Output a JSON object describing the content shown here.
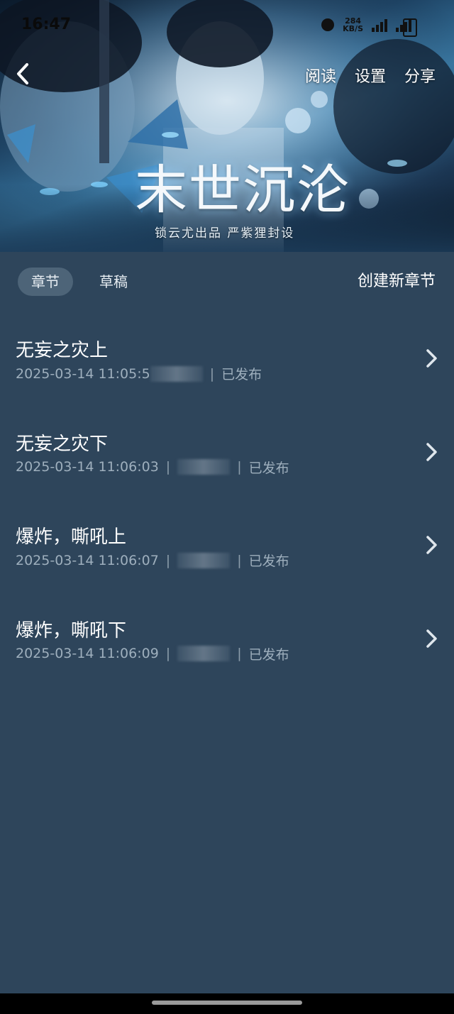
{
  "status_bar": {
    "time": "16:47",
    "net_speed": "284",
    "net_unit": "KB/S"
  },
  "header": {
    "back_icon": "chevron-left-icon",
    "actions": [
      "阅读",
      "设置",
      "分享"
    ]
  },
  "cover": {
    "title": "末世沉沦",
    "credits": "锁云尤出品  严紫狸封设"
  },
  "tabs": {
    "items": [
      "章节",
      "草稿"
    ],
    "selected": "章节",
    "create_label": "创建新章节"
  },
  "chapters": [
    {
      "title": "无妄之灾上",
      "time": "2025-03-14 11:05:5",
      "status": "已发布"
    },
    {
      "title": "无妄之灾下",
      "time": "2025-03-14 11:06:03",
      "status": "已发布"
    },
    {
      "title": "爆炸，嘶吼上",
      "time": "2025-03-14 11:06:07",
      "status": "已发布"
    },
    {
      "title": "爆炸，嘶吼下",
      "time": "2025-03-14 11:06:09",
      "status": "已发布"
    }
  ],
  "colors": {
    "background": "#2e455b",
    "tab_selected_bg": "#4d6478",
    "meta_text": "#9eafbd"
  }
}
